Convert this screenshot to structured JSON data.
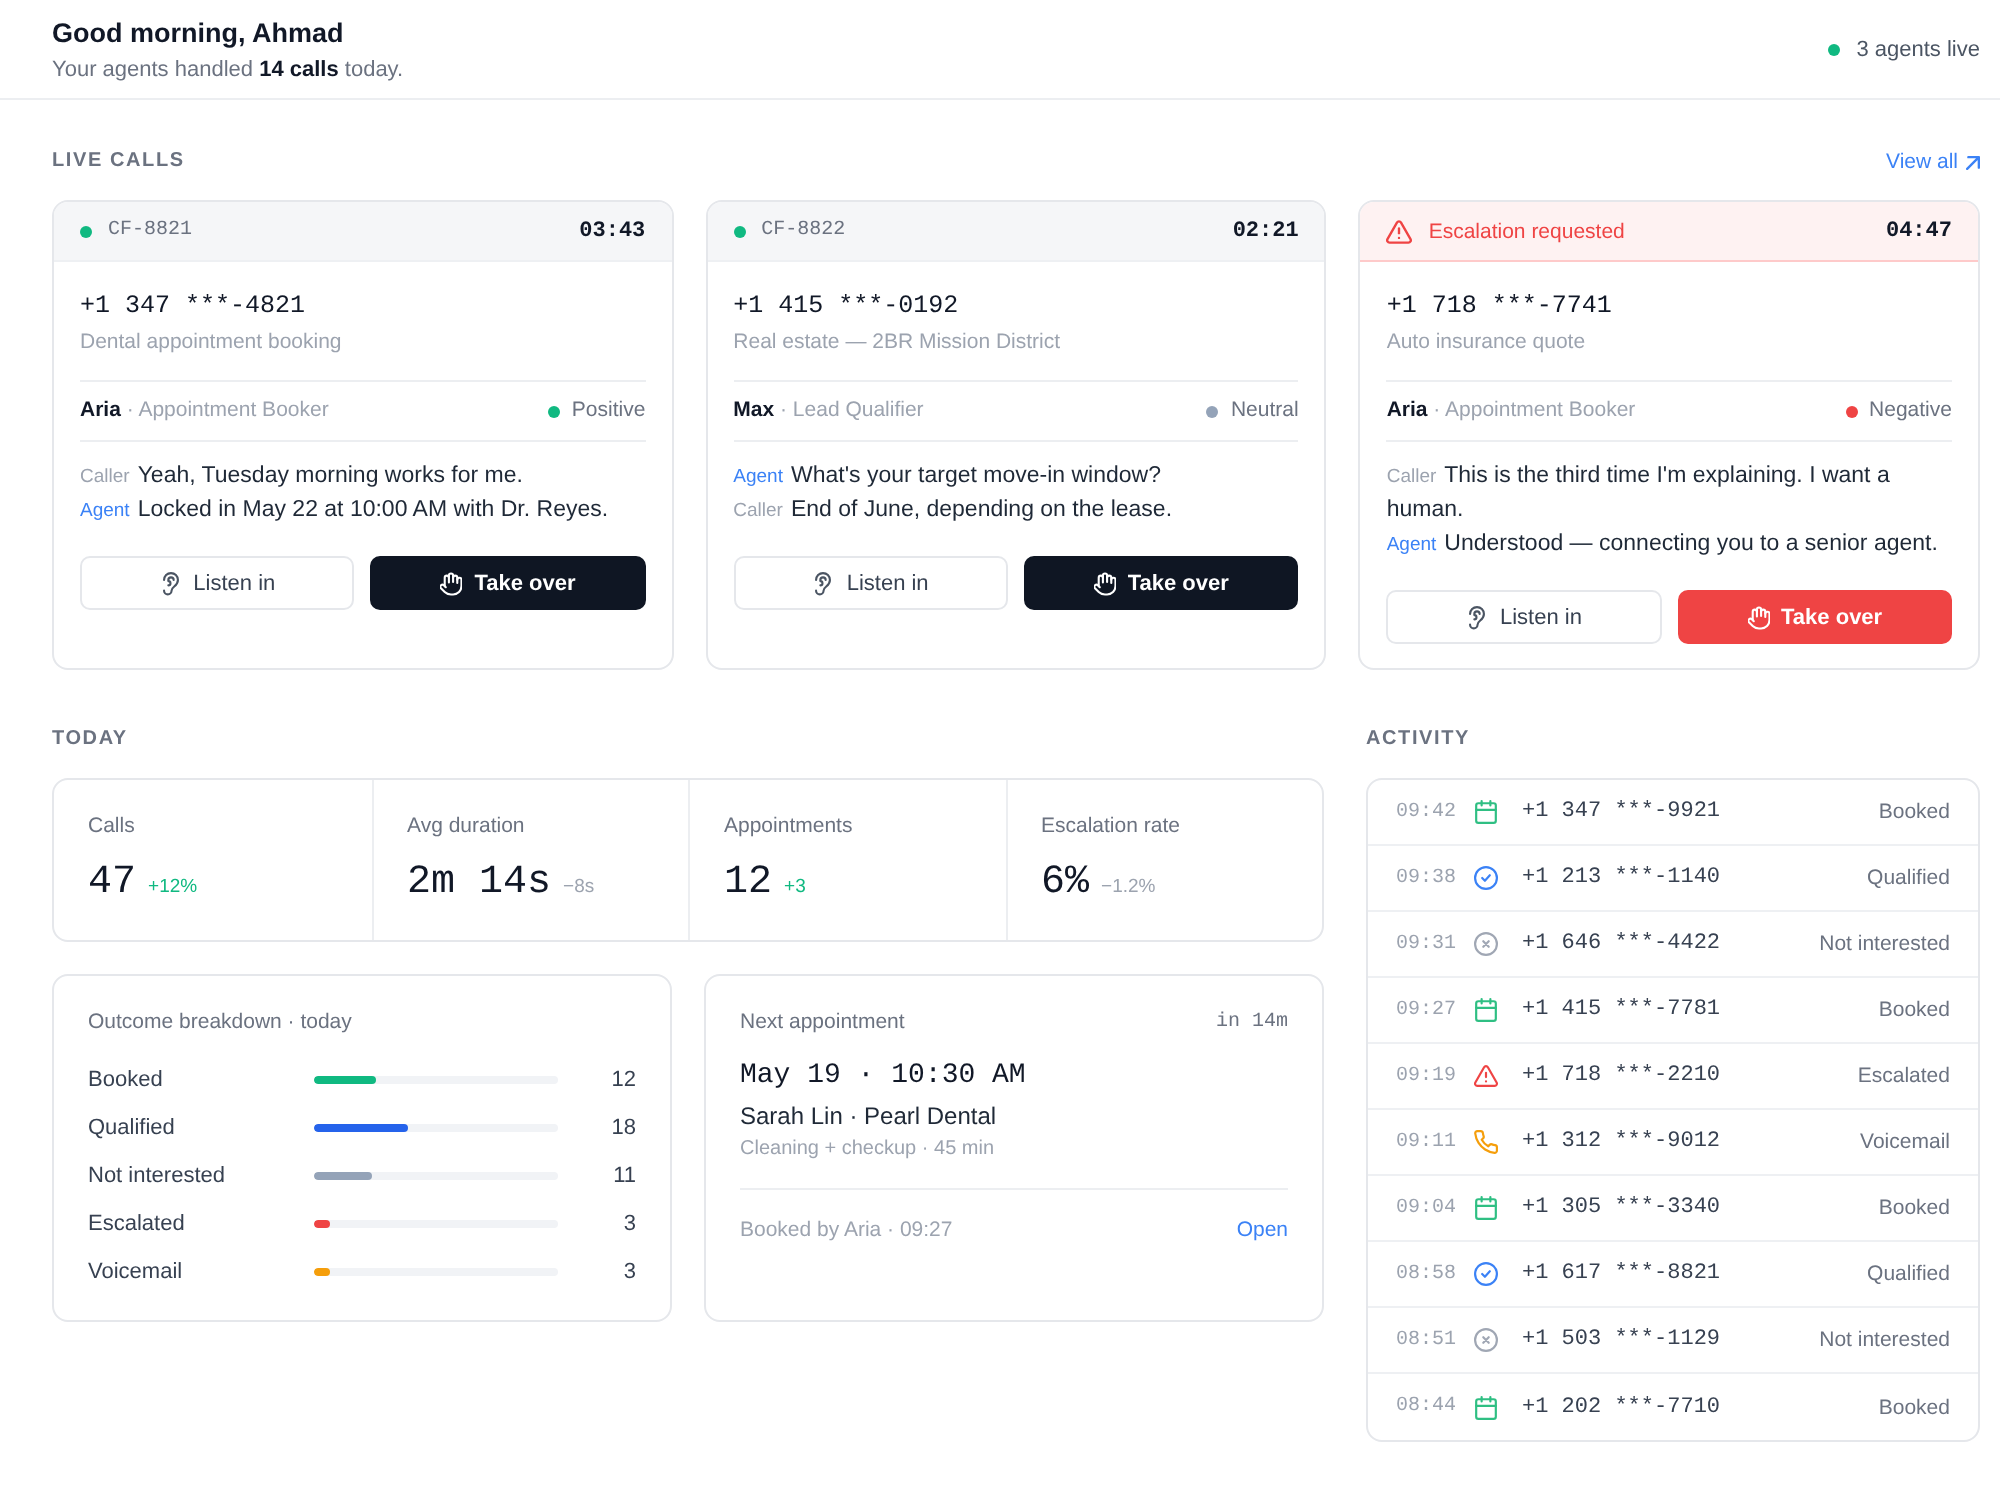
{
  "header": {
    "title": "Good morning, Ahmad",
    "subtitle": "Your agents handled **14 calls** today.",
    "live_label": "3 agents live"
  },
  "live_calls": {
    "heading": "LIVE CALLS",
    "view_all": "View all",
    "calls": [
      {
        "kind": "active",
        "header_label": "CF-8821",
        "duration": "03:43",
        "phone": "+1 347 ***-4821",
        "topic": "Dental appointment booking",
        "agent": "**Aria** · Appointment Booker",
        "sentiment": {
          "label": "Positive",
          "color": "#10b981"
        },
        "transcript": [
          {
            "kind": "caller",
            "speaker": "Caller",
            "text": "Yeah, Tuesday morning works for me."
          },
          {
            "kind": "agent",
            "speaker": "Agent",
            "text": "Locked in May 22 at 10:00 AM with Dr. Reyes."
          }
        ],
        "actions": [
          {
            "kind": "listen",
            "label": "Listen in"
          },
          {
            "kind": "takeover",
            "label": "Take over"
          }
        ]
      },
      {
        "kind": "active",
        "header_label": "CF-8822",
        "duration": "02:21",
        "phone": "+1 415 ***-0192",
        "topic": "Real estate — 2BR Mission District",
        "agent": "**Max** · Lead Qualifier",
        "sentiment": {
          "label": "Neutral",
          "color": "#94a3b8"
        },
        "transcript": [
          {
            "kind": "agent",
            "speaker": "Agent",
            "text": "What's your target move-in window?"
          },
          {
            "kind": "caller",
            "speaker": "Caller",
            "text": "End of June, depending on the lease."
          }
        ],
        "actions": [
          {
            "kind": "listen",
            "label": "Listen in"
          },
          {
            "kind": "takeover",
            "label": "Take over"
          }
        ]
      },
      {
        "kind": "escalated",
        "header_label": "Escalation requested",
        "duration": "04:47",
        "phone": "+1 718 ***-7741",
        "topic": "Auto insurance quote",
        "agent": "**Aria** · Appointment Booker",
        "sentiment": {
          "label": "Negative",
          "color": "#ef4444"
        },
        "transcript": [
          {
            "kind": "caller",
            "speaker": "Caller",
            "text": "This is the third time I'm explaining. I want a human."
          },
          {
            "kind": "agent",
            "speaker": "Agent",
            "text": "Understood — connecting you to a senior agent."
          }
        ],
        "actions": [
          {
            "kind": "listen",
            "label": "Listen in"
          },
          {
            "kind": "takeover",
            "label": "Take over"
          }
        ]
      }
    ]
  },
  "today": {
    "heading": "TODAY",
    "stats": [
      {
        "label": "Calls",
        "value": "47",
        "delta": "+12%",
        "color": "#10b981"
      },
      {
        "label": "Avg duration",
        "value": "2m 14s",
        "delta": "−8s",
        "color": "#9ca3af"
      },
      {
        "label": "Appointments",
        "value": "12",
        "delta": "+3",
        "color": "#10b981"
      },
      {
        "label": "Escalation rate",
        "value": "6%",
        "delta": "−1.2%",
        "color": "#9ca3af"
      }
    ],
    "outcomes": {
      "title": "Outcome breakdown · today",
      "rows": [
        {
          "label": "Booked",
          "count": "12",
          "level": 0.255,
          "color": "#10b981"
        },
        {
          "label": "Qualified",
          "count": "18",
          "level": 0.383,
          "color": "#2563eb"
        },
        {
          "label": "Not interested",
          "count": "11",
          "level": 0.234,
          "color": "#94a3b8"
        },
        {
          "label": "Escalated",
          "count": "3",
          "level": 0.064,
          "color": "#ef4444"
        },
        {
          "label": "Voicemail",
          "count": "3",
          "level": 0.064,
          "color": "#f59e0b"
        }
      ]
    },
    "next_appointment": {
      "title": "Next appointment",
      "eta": "in 14m",
      "when": "May 19 · 10:30 AM",
      "who": "Sarah Lin · Pearl Dental",
      "details": "Cleaning + checkup · 45 min",
      "booked_by": "Booked by Aria · 09:27",
      "link": "Open"
    }
  },
  "activity": {
    "heading": "ACTIVITY",
    "items": [
      {
        "time": "09:42",
        "kind": "booked",
        "phone": "+1 347 ***-9921",
        "outcome": "Booked"
      },
      {
        "time": "09:38",
        "kind": "qualified",
        "phone": "+1 213 ***-1140",
        "outcome": "Qualified"
      },
      {
        "time": "09:31",
        "kind": "not_interested",
        "phone": "+1 646 ***-4422",
        "outcome": "Not interested"
      },
      {
        "time": "09:27",
        "kind": "booked",
        "phone": "+1 415 ***-7781",
        "outcome": "Booked"
      },
      {
        "time": "09:19",
        "kind": "escalated",
        "phone": "+1 718 ***-2210",
        "outcome": "Escalated"
      },
      {
        "time": "09:11",
        "kind": "voicemail",
        "phone": "+1 312 ***-9012",
        "outcome": "Voicemail"
      },
      {
        "time": "09:04",
        "kind": "booked",
        "phone": "+1 305 ***-3340",
        "outcome": "Booked"
      },
      {
        "time": "08:58",
        "kind": "qualified",
        "phone": "+1 617 ***-8821",
        "outcome": "Qualified"
      },
      {
        "time": "08:51",
        "kind": "not_interested",
        "phone": "+1 503 ***-1129",
        "outcome": "Not interested"
      },
      {
        "time": "08:44",
        "kind": "booked",
        "phone": "+1 202 ***-7710",
        "outcome": "Booked"
      }
    ]
  }
}
